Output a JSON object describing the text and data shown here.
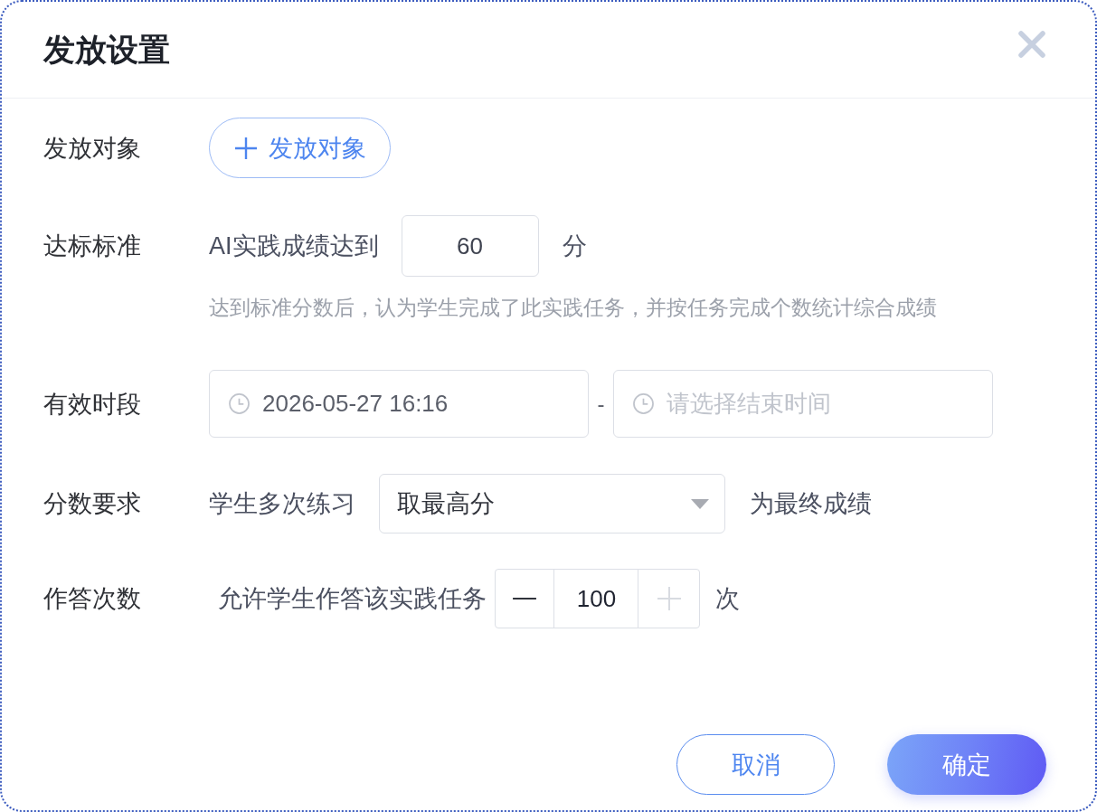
{
  "dialog": {
    "title": "发放设置"
  },
  "rows": [
    {
      "kind": "add",
      "label": "发放对象",
      "button": "发放对象"
    },
    {
      "kind": "threshold",
      "label": "达标标准",
      "prefix": "AI实践成绩达到",
      "value": "60",
      "suffix": "分",
      "hint": "达到标准分数后，认为学生完成了此实践任务，并按任务完成个数统计综合成绩"
    },
    {
      "kind": "date_range",
      "label": "有效时段",
      "start": {
        "value": "2026-05-27 16:16"
      },
      "separator": "-",
      "end": {
        "placeholder": "请选择结束时间"
      }
    },
    {
      "kind": "select",
      "label": "分数要求",
      "prefix": "学生多次练习",
      "value": "取最高分",
      "suffix": "为最终成绩"
    },
    {
      "kind": "stepper",
      "label": "作答次数",
      "prefix": "允许学生作答该实践任务",
      "value": "100",
      "minus_disabled": false,
      "plus_disabled": true,
      "suffix": "次"
    }
  ],
  "footer": {
    "buttons": [
      {
        "label": "取消",
        "kind": "secondary"
      },
      {
        "label": "确定",
        "kind": "primary"
      }
    ]
  }
}
